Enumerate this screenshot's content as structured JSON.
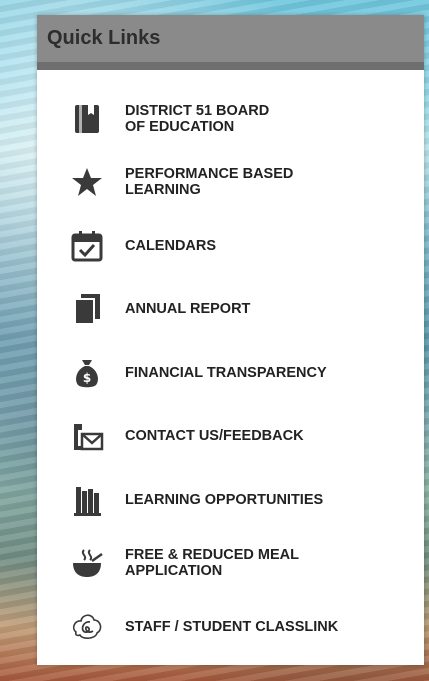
{
  "panel": {
    "title": "Quick Links"
  },
  "links": [
    {
      "label": "DISTRICT 51 BOARD\nOF EDUCATION",
      "icon": "book-icon"
    },
    {
      "label": "PERFORMANCE BASED\nLEARNING",
      "icon": "star-icon"
    },
    {
      "label": "CALENDARS",
      "icon": "calendar-check-icon"
    },
    {
      "label": "ANNUAL REPORT",
      "icon": "documents-icon"
    },
    {
      "label": "FINANCIAL TRANSPARENCY",
      "icon": "money-bag-icon"
    },
    {
      "label": "CONTACT US/FEEDBACK",
      "icon": "phone-mail-icon"
    },
    {
      "label": "LEARNING OPPORTUNITIES",
      "icon": "books-shelf-icon"
    },
    {
      "label": "FREE & REDUCED MEAL\nAPPLICATION",
      "icon": "soup-bowl-icon"
    },
    {
      "label": "STAFF / STUDENT CLASSLINK",
      "icon": "classlink-logo-icon"
    }
  ],
  "colors": {
    "header_bg": "#8a8a8a",
    "header_border": "#6f6f6f",
    "icon": "#3a3a3a"
  }
}
